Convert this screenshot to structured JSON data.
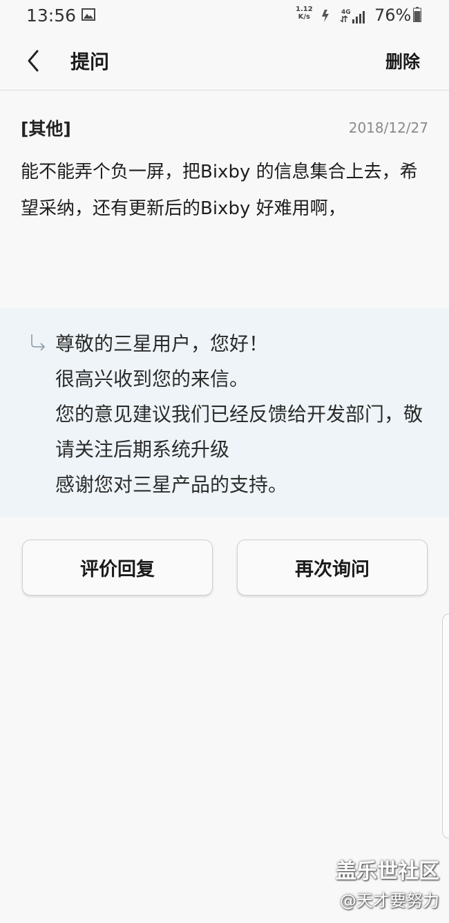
{
  "status_bar": {
    "time": "13:56",
    "net_speed_top": "1.12",
    "net_speed_unit": "K/s",
    "network_type": "4G",
    "battery": "76%",
    "icons": [
      "image-icon",
      "data-transfer-icon",
      "signal-icon",
      "battery-icon"
    ]
  },
  "header": {
    "title": "提问",
    "delete_label": "删除"
  },
  "question": {
    "category": "[其他]",
    "date": "2018/12/27",
    "body": "能不能弄个负一屏，把Bixby 的信息集合上去，希望采纳，还有更新后的Bixby 好难用啊，"
  },
  "reply": {
    "lines": [
      "尊敬的三星用户，您好！",
      "很高兴收到您的来信。",
      "您的意见建议我们已经反馈给开发部门，敬请关注后期系统升级",
      "感谢您对三星产品的支持。"
    ]
  },
  "actions": {
    "rate_label": "评价回复",
    "ask_again_label": "再次询问"
  },
  "watermark": {
    "title": "盖乐世社区",
    "user": "@天才要努力"
  },
  "colors": {
    "background": "#f8f8f8",
    "reply_background": "#eef4f7",
    "date_text": "#8a8a8a"
  }
}
